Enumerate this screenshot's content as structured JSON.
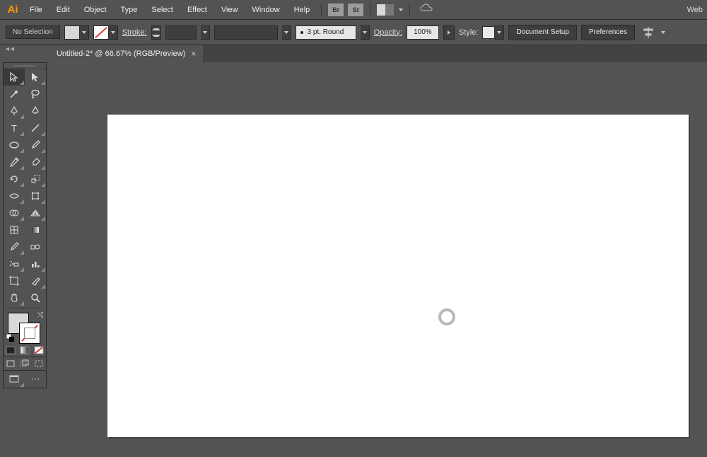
{
  "app": {
    "logo": "Ai",
    "right_link": "Web"
  },
  "menu": {
    "items": [
      "File",
      "Edit",
      "Object",
      "Type",
      "Select",
      "Effect",
      "View",
      "Window",
      "Help"
    ],
    "ext1": "Br",
    "ext2": "St"
  },
  "control": {
    "selection_state": "No Selection",
    "stroke_label": "Stroke:",
    "brush_profile": "3 pt. Round",
    "opacity_label": "Opacity:",
    "opacity_value": "100%",
    "style_label": "Style:",
    "doc_setup": "Document Setup",
    "prefs": "Preferences"
  },
  "doc_tab": {
    "title": "Untitled-2* @ 66.67% (RGB/Preview)"
  },
  "tools": {
    "rows": [
      [
        "selection",
        "direct-selection"
      ],
      [
        "magic-wand",
        "lasso"
      ],
      [
        "pen",
        "curvature"
      ],
      [
        "type",
        "line-segment"
      ],
      [
        "ellipse",
        "paintbrush"
      ],
      [
        "pencil",
        "eraser"
      ],
      [
        "rotate",
        "scale"
      ],
      [
        "width",
        "free-transform"
      ],
      [
        "shape-builder",
        "perspective-grid"
      ],
      [
        "mesh",
        "gradient"
      ],
      [
        "eyedropper",
        "blend"
      ],
      [
        "symbol-sprayer",
        "column-graph"
      ],
      [
        "artboard",
        "slice"
      ],
      [
        "hand",
        "zoom"
      ]
    ],
    "modes": [
      "color",
      "gradient",
      "none"
    ],
    "screens": [
      "normal",
      "full"
    ]
  }
}
